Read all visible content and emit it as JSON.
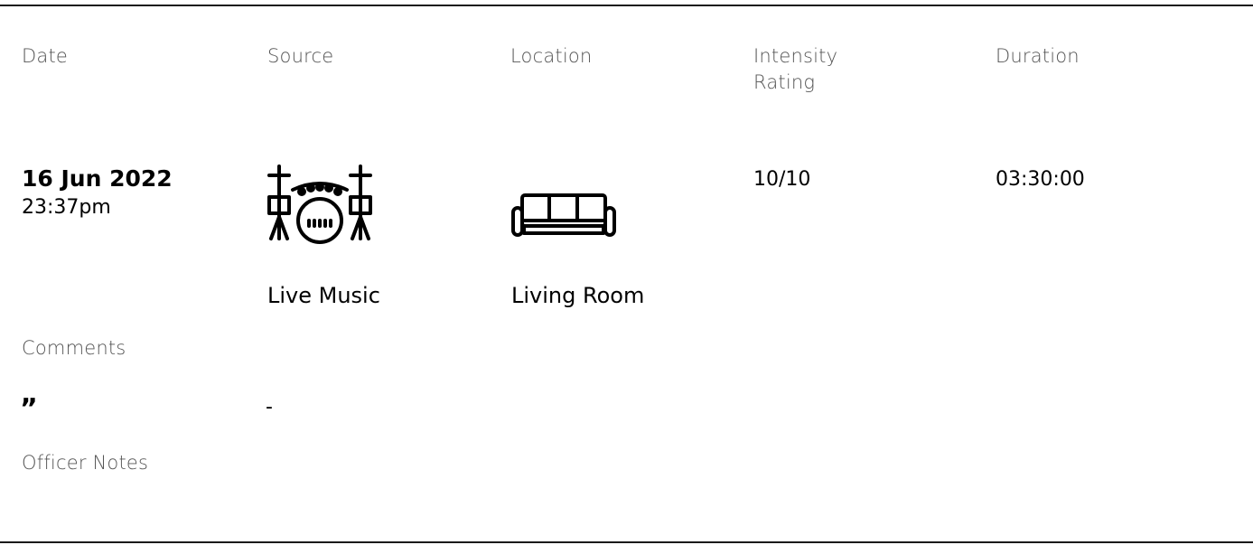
{
  "headers": {
    "date": "Date",
    "source": "Source",
    "location": "Location",
    "intensity": "Intensity Rating",
    "duration": "Duration"
  },
  "record": {
    "date": "16 Jun 2022",
    "time": "23:37pm",
    "source": {
      "label": "Live Music",
      "icon": "drum-kit-icon"
    },
    "location": {
      "label": "Living Room",
      "icon": "sofa-icon"
    },
    "intensity": "10/10",
    "duration": "03:30:00"
  },
  "comments": {
    "label": "Comments",
    "quote_icon": "quote-icon",
    "quote_glyph": "”",
    "value": "-"
  },
  "officer_notes": {
    "label": "Officer Notes"
  }
}
